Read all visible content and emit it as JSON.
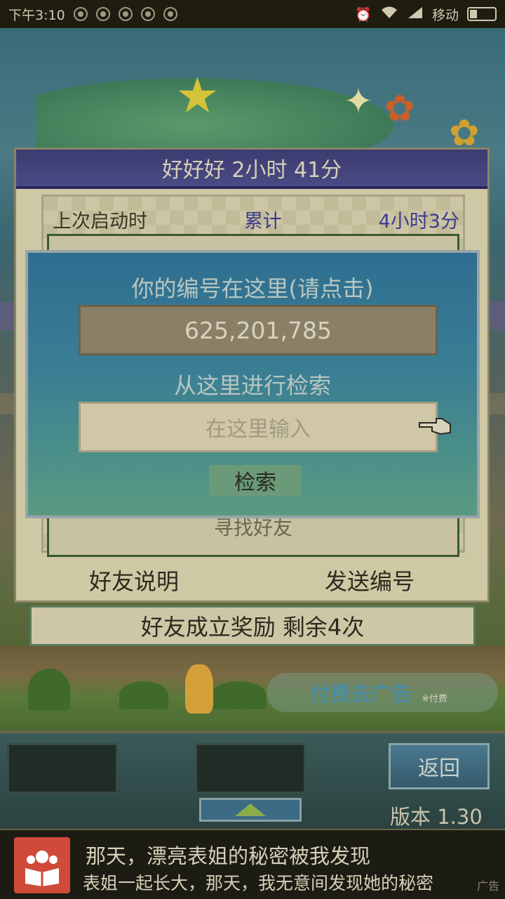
{
  "status_bar": {
    "time": "下午3:10",
    "carrier": "移动"
  },
  "panel": {
    "title": "好好好  2小时 41分",
    "last_launch_label": "上次启动时",
    "total_label": "累计",
    "total_value": "4小时3分",
    "find_friend_label": "寻找好友",
    "friend_explain_button": "好友说明",
    "send_id_button": "发送编号"
  },
  "reward_bar": {
    "text": "好友成立奖励  剩余4次"
  },
  "dialog": {
    "your_id_label": "你的编号在这里(请点击)",
    "your_id_value": "625,201,785",
    "search_label": "从这里进行检索",
    "search_placeholder": "在这里输入",
    "search_button": "检索"
  },
  "scene": {
    "remove_ad_label": "付费去广告",
    "paid_note": "※付费"
  },
  "hud": {
    "back_button": "返回",
    "version": "版本 1.30"
  },
  "ad": {
    "title": "那天，漂亮表姐的秘密被我发现",
    "subtitle": "表姐一起长大，那天，我无意间发现她的秘密",
    "tag": "广告"
  },
  "colors": {
    "dialog_bg": "#3a7e94",
    "title_bar": "#3c3c70",
    "accent_blue_text": "#3a3a90",
    "ad_icon": "#d04a3a"
  }
}
